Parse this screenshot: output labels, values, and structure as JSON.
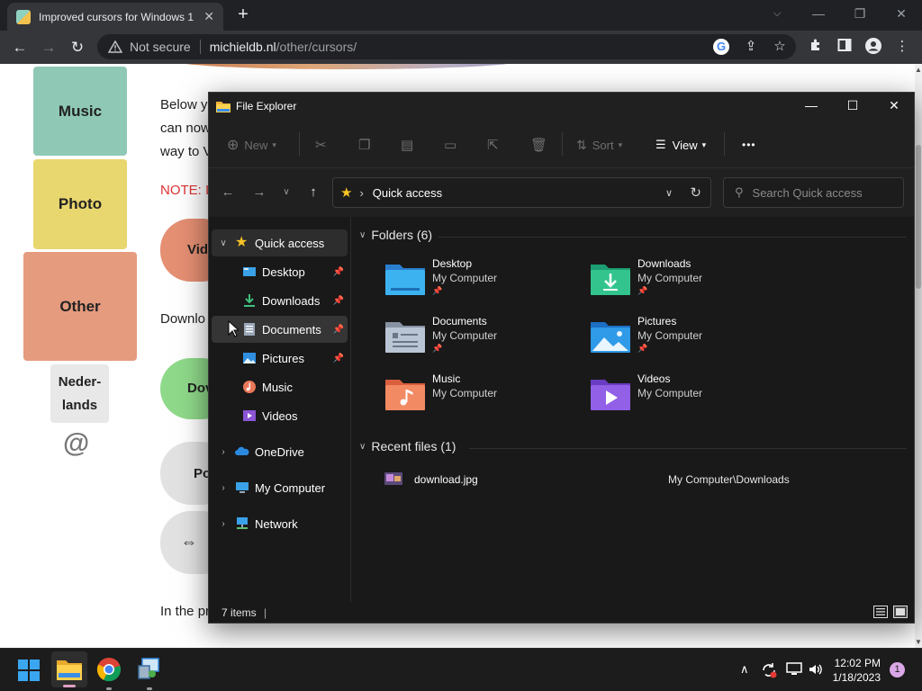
{
  "browser": {
    "tab_title": "Improved cursors for Windows 1",
    "url_security": "Not secure",
    "url_host": "michieldb.nl",
    "url_path": "/other/cursors/"
  },
  "webpage": {
    "nav_tiles": [
      {
        "label": "Music",
        "color": "#8fc9b5"
      },
      {
        "label": "Photo",
        "color": "#e8d66e"
      },
      {
        "label": "Other",
        "color": "#e59b7e"
      },
      {
        "label": "Neder-\nlands",
        "color": "#e8e8e8"
      }
    ],
    "at_symbol": "@",
    "para_1_line_1": "Below y",
    "para_1_line_2": "can now",
    "para_1_line_3": "way to V",
    "note": "NOTE: I",
    "download_text": "Downlo",
    "footer_text": "In the pr",
    "pill_labels": [
      "Vid",
      "Dov",
      "Po",
      "⇔"
    ]
  },
  "explorer": {
    "title": "File Explorer",
    "commands": {
      "new": "New",
      "sort": "Sort",
      "view": "View",
      "more": "•••"
    },
    "address": "Quick access",
    "search_placeholder": "Search Quick access",
    "sidebar": {
      "quick_access": "Quick access",
      "items": [
        {
          "label": "Desktop",
          "pinned": true
        },
        {
          "label": "Downloads",
          "pinned": true
        },
        {
          "label": "Documents",
          "pinned": true
        },
        {
          "label": "Pictures",
          "pinned": true
        },
        {
          "label": "Music",
          "pinned": false
        },
        {
          "label": "Videos",
          "pinned": false
        }
      ],
      "onedrive": "OneDrive",
      "my_computer": "My Computer",
      "network": "Network"
    },
    "folders_header": "Folders (6)",
    "folders": [
      {
        "name": "Desktop",
        "location": "My Computer",
        "pinned": true
      },
      {
        "name": "Downloads",
        "location": "My Computer",
        "pinned": true
      },
      {
        "name": "Documents",
        "location": "My Computer",
        "pinned": true
      },
      {
        "name": "Pictures",
        "location": "My Computer",
        "pinned": true
      },
      {
        "name": "Music",
        "location": "My Computer",
        "pinned": false
      },
      {
        "name": "Videos",
        "location": "My Computer",
        "pinned": false
      }
    ],
    "recent_header": "Recent files (1)",
    "recent_files": [
      {
        "name": "download.jpg",
        "path": "My Computer\\Downloads"
      }
    ],
    "status": "7 items"
  },
  "taskbar": {
    "time": "12:02 PM",
    "date": "1/18/2023",
    "notification_count": "1"
  }
}
